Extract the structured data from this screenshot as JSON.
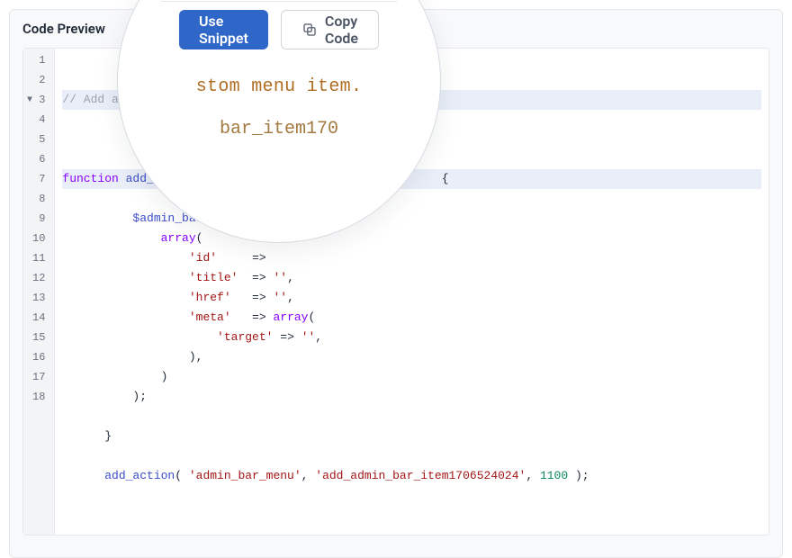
{
  "panel": {
    "title": "Code Preview"
  },
  "buttons": {
    "use_snippet": "Use Snippet",
    "copy_code": "Copy Code"
  },
  "magnifier": {
    "line1": "stom menu item.",
    "line2_pre": "bar_item170",
    "line2_fade": ""
  },
  "gutter": [
    "1",
    "2",
    "3",
    "4",
    "5",
    "6",
    "7",
    "8",
    "9",
    "10",
    "11",
    "12",
    "13",
    "14",
    "15",
    "16",
    "17",
    "18"
  ],
  "code": {
    "l1_comment": "// Add a",
    "l3_kw": "function",
    "l3_fn": " add_",
    "l3_tail": "                                         {",
    "l4_var": "    $admin_bar",
    "l5_kw": "        array",
    "l5_paren": "(",
    "l6_pre": "            ",
    "l6_key": "'id'",
    "l6_mid": "     =>",
    "l7_pre": "            ",
    "l7_key": "'title'",
    "l7_mid": "  => ",
    "l7_str": "''",
    "l7_end": ",",
    "l8_pre": "            ",
    "l8_key": "'href'",
    "l8_mid": "   => ",
    "l8_str": "''",
    "l8_end": ",",
    "l9_pre": "            ",
    "l9_key": "'meta'",
    "l9_mid": "   => ",
    "l9_kw": "array",
    "l9_end": "(",
    "l10_pre": "                ",
    "l10_key": "'target'",
    "l10_mid": " => ",
    "l10_str": "''",
    "l10_end": ",",
    "l11": "            ),",
    "l12": "        )",
    "l13": "    );",
    "l14": "",
    "l15": "}",
    "l16": "",
    "l17_fn": "add_action",
    "l17_p1": "( ",
    "l17_s1": "'admin_bar_menu'",
    "l17_c1": ", ",
    "l17_s2": "'add_admin_bar_item1706524024'",
    "l17_c2": ", ",
    "l17_num": "1100",
    "l17_end": " );"
  }
}
